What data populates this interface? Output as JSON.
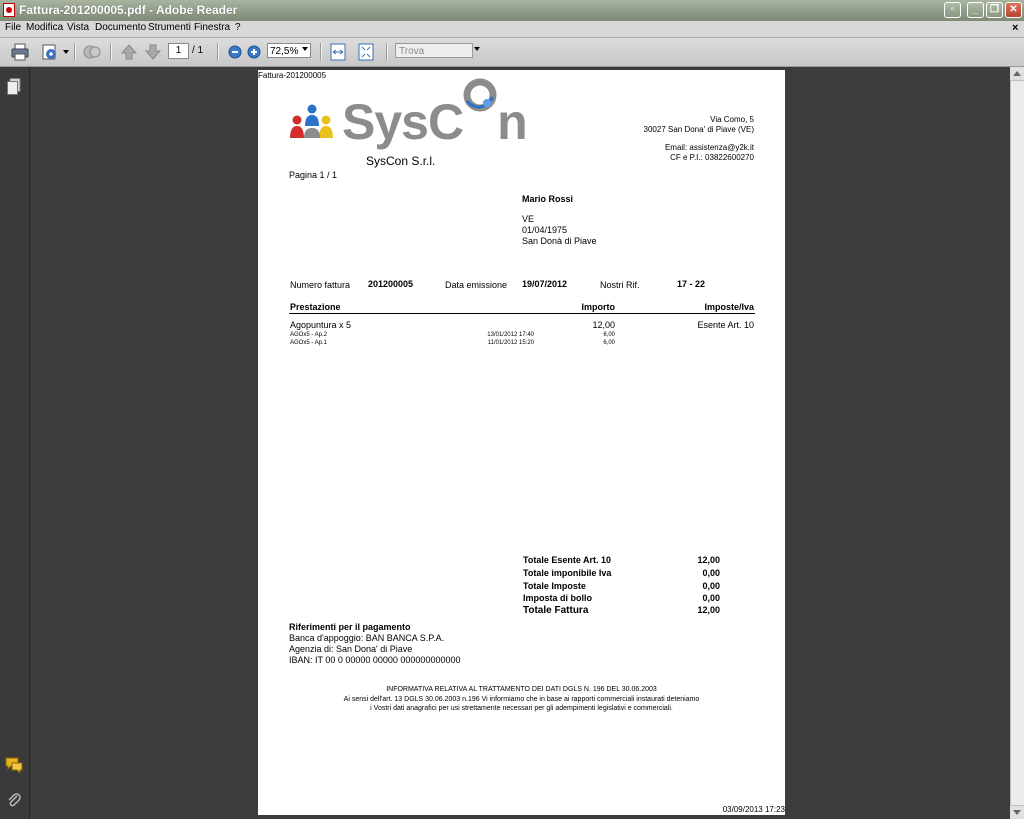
{
  "window": {
    "title": "Fattura-201200005.pdf - Adobe Reader"
  },
  "menu": [
    "File",
    "Modifica",
    "Vista",
    "Documento",
    "Strumenti",
    "Finestra",
    "?"
  ],
  "toolbar": {
    "page_current": "1",
    "page_total": "/ 1",
    "zoom": "72,5%",
    "find_placeholder": "Trova"
  },
  "document": {
    "header_filename": "Fattura-201200005",
    "company": {
      "logo_text_a": "SysC",
      "logo_text_b": "n",
      "name": "SysCon S.r.l.",
      "address1": "Via Como, 5",
      "address2": "30027 San Dona' di Piave (VE)",
      "email": "Email: assistenza@y2k.it",
      "vat": "CF e P.I.: 03822600270"
    },
    "page_label": "Pagina 1 / 1",
    "customer": {
      "name": "Mario Rossi",
      "province": "VE",
      "birthdate": "01/04/1975",
      "city": "San Donà di Piave"
    },
    "invoice": {
      "number_label": "Numero fattura",
      "number": "201200005",
      "date_label": "Data emissione",
      "date": "19/07/2012",
      "ref_label": "Nostri Rif.",
      "ref": "17 - 22"
    },
    "table_headers": {
      "service": "Prestazione",
      "amount": "Importo",
      "tax": "Imposte/Iva"
    },
    "main_item": {
      "name": "Agopuntura x 5",
      "amount": "12,00",
      "tax": "Esente Art. 10"
    },
    "sub_items": [
      {
        "name": "AGOx5 - Ap.2",
        "datetime": "13/01/2012 17:40",
        "amount": "6,00"
      },
      {
        "name": "AGOx5 - Ap.1",
        "datetime": "11/01/2012 15:20",
        "amount": "6,00"
      }
    ],
    "totals": [
      {
        "label": "Totale Esente Art. 10",
        "value": "12,00"
      },
      {
        "label": "Totale imponibile Iva",
        "value": "0,00"
      },
      {
        "label": "Totale Imposte",
        "value": "0,00"
      },
      {
        "label": "Imposta di bollo",
        "value": "0,00"
      },
      {
        "label": "Totale Fattura",
        "value": "12,00"
      }
    ],
    "payment": {
      "title": "Riferimenti per il pagamento",
      "bank": "Banca d'appoggio: BAN BANCA S.P.A.",
      "branch": "Agenzia di: San Dona' di Piave",
      "iban": "IBAN: IT 00 0 00000 00000 000000000000"
    },
    "privacy": {
      "title": "INFORMATIVA RELATIVA AL TRATTAMENTO DEI DATI DGLS N. 196 DEL 30.06.2003",
      "line1": "Ai sensi dell'art. 13 DGLS 30.06.2003 n.196 Vi informiamo che in base ai rapporti commerciali instaurati deteniamo",
      "line2": "i Vostri dati anagrafici per usi strettamente necessari per gli adempimenti legislativi e commerciali."
    },
    "footer_timestamp": "03/09/2013 17:23"
  },
  "colors": {
    "logo_gray": "#8c8c8c",
    "logo_red": "#d22e2e",
    "logo_yellow": "#e8c21a",
    "logo_blue": "#2b72c9",
    "titlebar": "#8e9a85"
  }
}
